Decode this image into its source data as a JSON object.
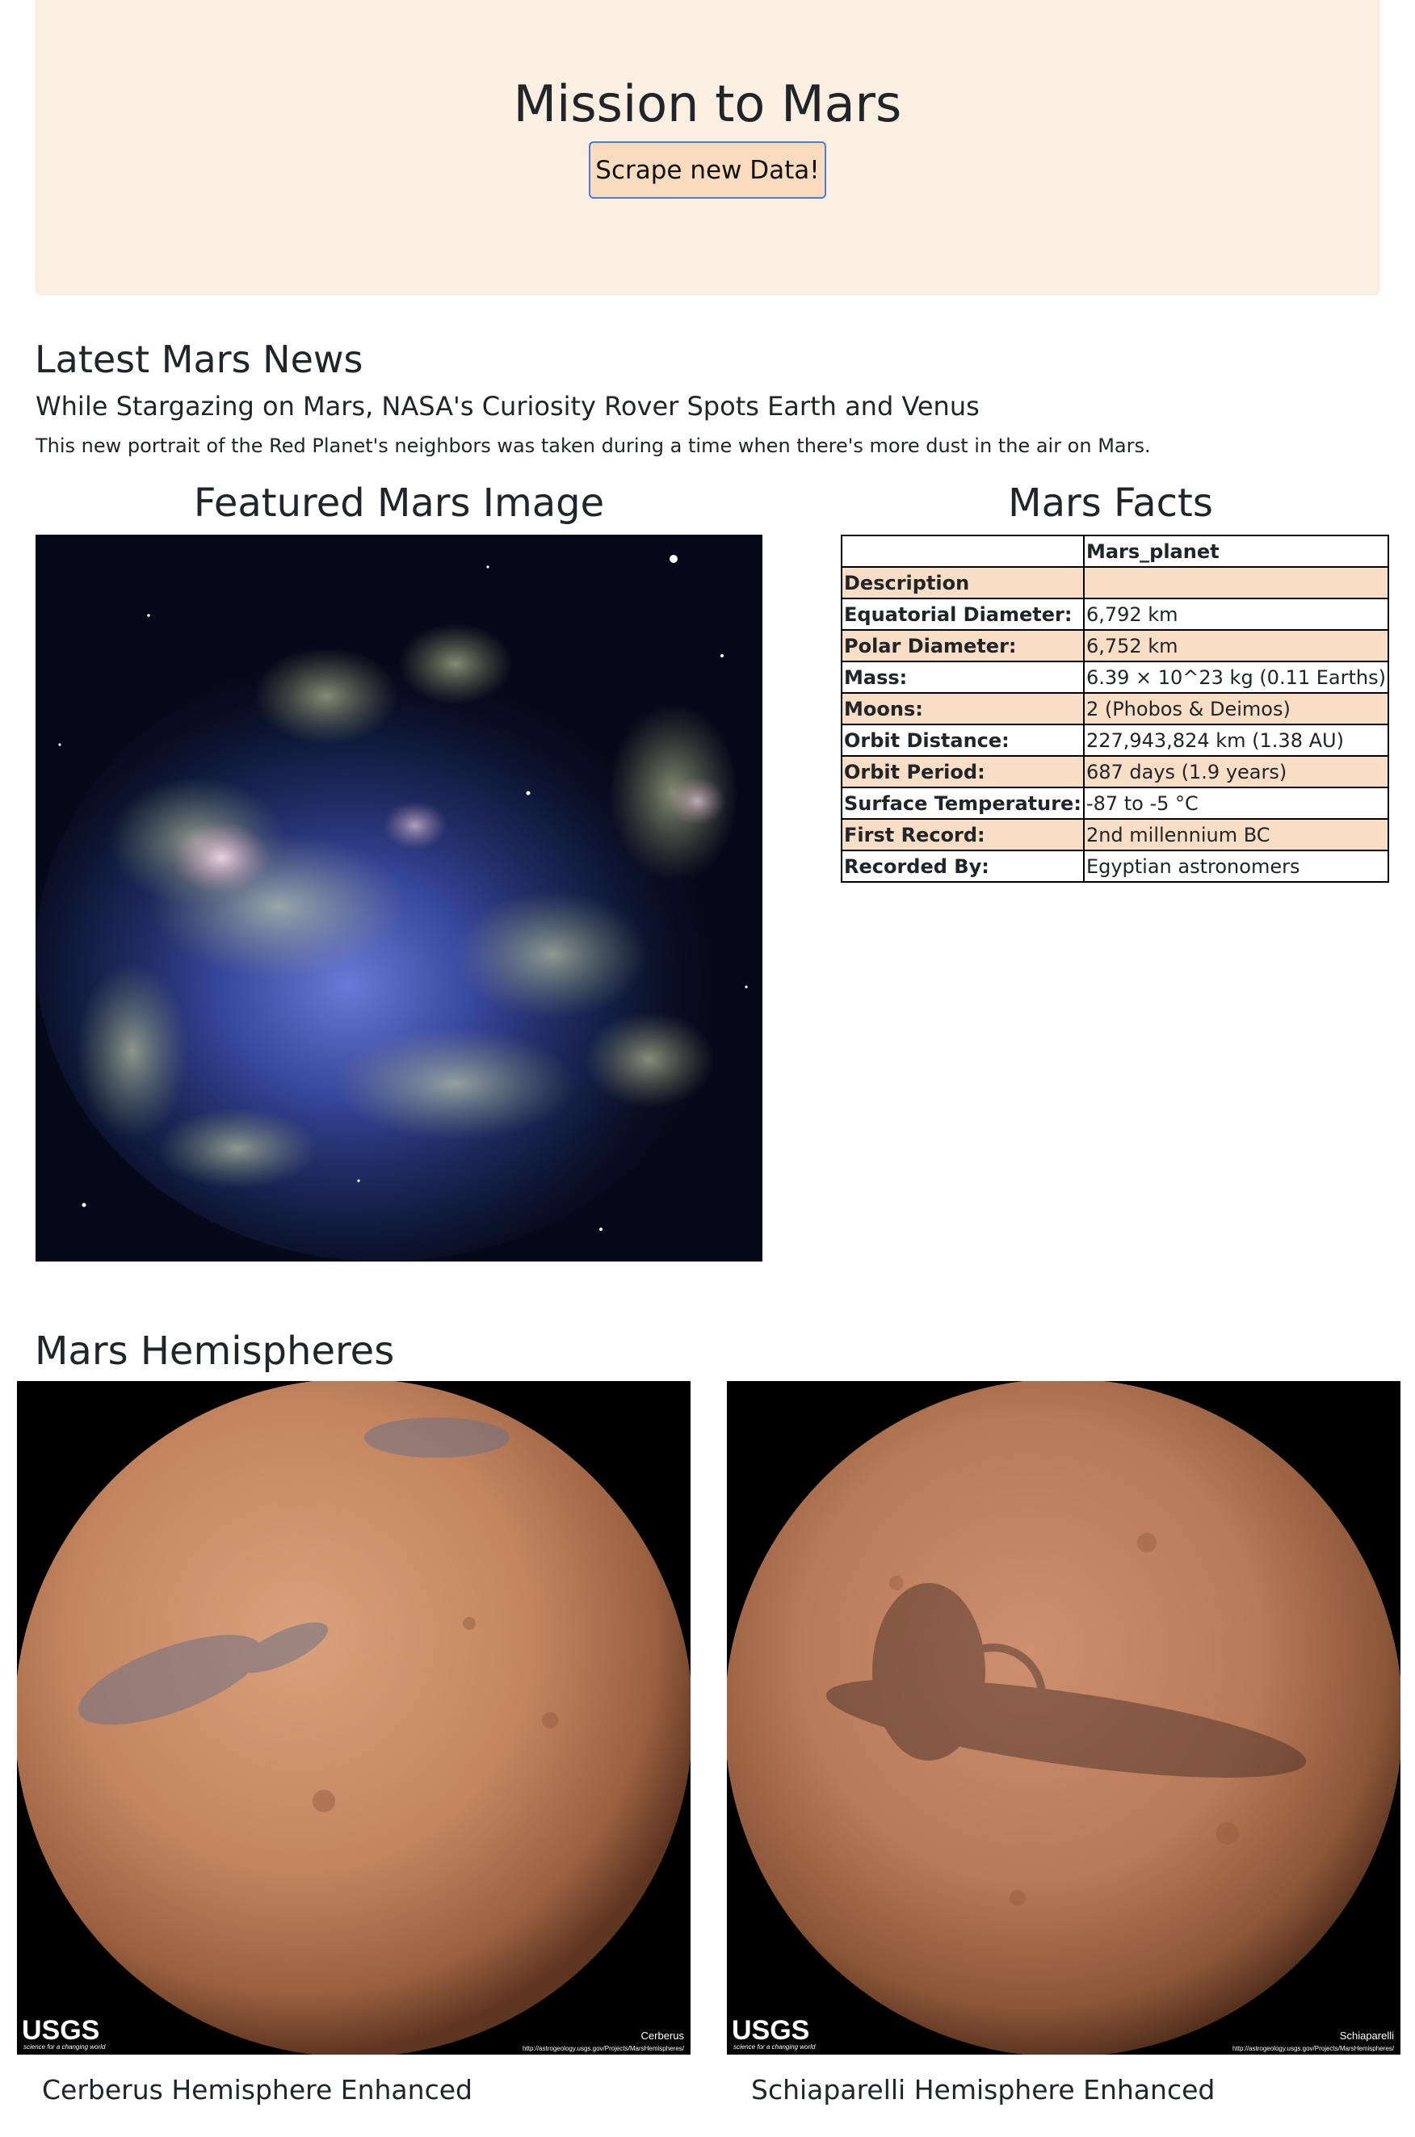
{
  "header": {
    "title": "Mission to Mars",
    "scrape_button": "Scrape new Data!"
  },
  "news": {
    "heading": "Latest Mars News",
    "title": "While Stargazing on Mars, NASA's Curiosity Rover Spots Earth and Venus",
    "paragraph": "This new portrait of the Red Planet's neighbors was taken during a time when there's more dust in the air on Mars."
  },
  "featured": {
    "heading": "Featured Mars Image"
  },
  "facts": {
    "heading": "Mars Facts",
    "column_header": "Mars_planet",
    "rows": [
      {
        "label": "Description",
        "value": ""
      },
      {
        "label": "Equatorial Diameter:",
        "value": "6,792 km"
      },
      {
        "label": "Polar Diameter:",
        "value": "6,752 km"
      },
      {
        "label": "Mass:",
        "value": "6.39 × 10^23 kg (0.11 Earths)"
      },
      {
        "label": "Moons:",
        "value": "2 (Phobos & Deimos)"
      },
      {
        "label": "Orbit Distance:",
        "value": "227,943,824 km (1.38 AU)"
      },
      {
        "label": "Orbit Period:",
        "value": "687 days (1.9 years)"
      },
      {
        "label": "Surface Temperature:",
        "value": "-87 to -5 °C"
      },
      {
        "label": "First Record:",
        "value": "2nd millennium BC"
      },
      {
        "label": "Recorded By:",
        "value": "Egyptian astronomers"
      }
    ]
  },
  "hemispheres": {
    "heading": "Mars Hemispheres",
    "items": [
      {
        "title": "Cerberus Hemisphere Enhanced",
        "image_label": "Cerberus",
        "logo": "USGS",
        "tagline": "science for a changing world",
        "url": "http://astrogeology.usgs.gov/Projects/MarsHemispheres/"
      },
      {
        "title": "Schiaparelli Hemisphere Enhanced",
        "image_label": "Schiaparelli",
        "logo": "USGS",
        "tagline": "science for a changing world",
        "url": "http://astrogeology.usgs.gov/Projects/MarsHemispheres/"
      }
    ]
  },
  "colors": {
    "jumbotron_bg": "#faefe0",
    "button_bg": "#f9dbbd",
    "button_border": "#4a7be0",
    "table_stripe": "#f9dec6"
  }
}
